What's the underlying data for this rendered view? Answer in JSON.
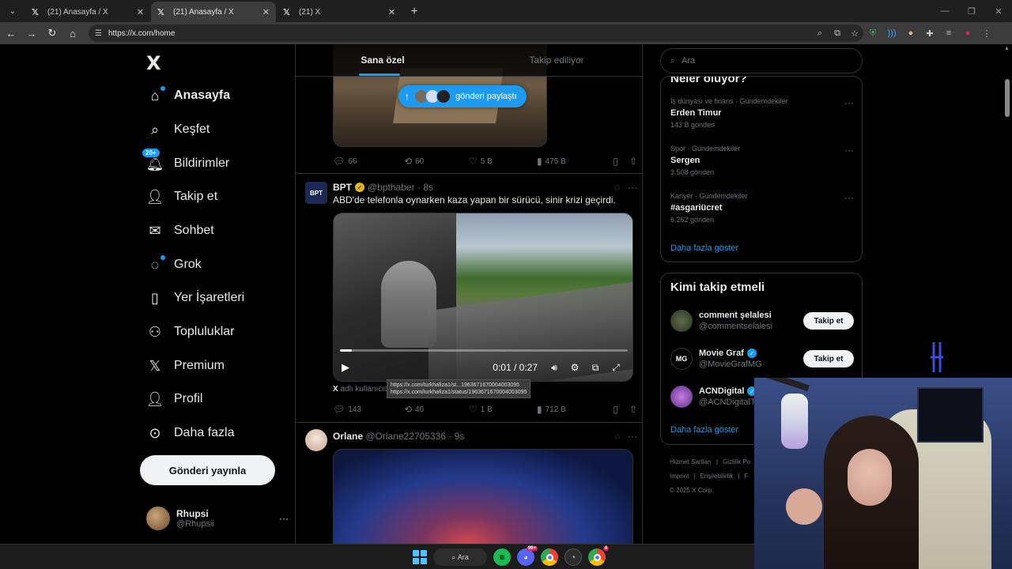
{
  "browser": {
    "tabs": [
      {
        "title": "(21) Anasayfa / X",
        "active": false
      },
      {
        "title": "(21) Anasayfa / X",
        "active": true
      },
      {
        "title": "(21) X",
        "active": false
      }
    ],
    "url": "https://x.com/home"
  },
  "sidebar": {
    "logo": "X",
    "items": [
      {
        "label": "Anasayfa",
        "icon": "home-icon"
      },
      {
        "label": "Keşfet",
        "icon": "search-icon"
      },
      {
        "label": "Bildirimler",
        "icon": "bell-icon",
        "badge": "20+"
      },
      {
        "label": "Takip et",
        "icon": "follow-icon"
      },
      {
        "label": "Sohbet",
        "icon": "mail-icon"
      },
      {
        "label": "Grok",
        "icon": "grok-icon"
      },
      {
        "label": "Yer İşaretleri",
        "icon": "bookmark-icon"
      },
      {
        "label": "Topluluklar",
        "icon": "communities-icon"
      },
      {
        "label": "Premium",
        "icon": "x-premium-icon"
      },
      {
        "label": "Profil",
        "icon": "profile-icon"
      },
      {
        "label": "Daha fazla",
        "icon": "more-circle-icon"
      }
    ],
    "post_button": "Gönderi yayınla",
    "account": {
      "name": "Rhupsi",
      "handle": "@Rhupsii"
    }
  },
  "timeline": {
    "tabs": [
      "Sana özel",
      "Takip ediliyor"
    ],
    "share_pill": "gönderi paylaştı",
    "post1_actions": {
      "replies": "66",
      "reposts": "60",
      "likes": "5 B",
      "views": "475 B"
    },
    "post2": {
      "name": "BPT",
      "handle": "@bpthaber",
      "time": "8s",
      "text": "ABD'de telefonla oynarken kaza yapan bir sürücü, sinir krizi geçirdi.",
      "video_time": "0:01 / 0:27",
      "video_progress": 0.04,
      "caption_prefix": "X",
      "caption_text": "adlı kullanıcıd",
      "tooltip_line1": "https://x.com/turkhafiza1/st...1963671670004003095",
      "tooltip_line2": "https://x.com/turkhafiza1/status/1963671670004003095",
      "actions": {
        "replies": "143",
        "reposts": "46",
        "likes": "1 B",
        "views": "712 B"
      }
    },
    "post3": {
      "name": "Orlane",
      "handle": "@Orlane22705336",
      "time": "9s"
    }
  },
  "right": {
    "search_placeholder": "Ara",
    "whats_happening_title": "Neler oluyor?",
    "trends": [
      {
        "meta": "İş dünyası ve finans · Gündemdekiler",
        "name": "Erden Timur",
        "count": "143 B gönderi"
      },
      {
        "meta": "Spor · Gündemdekiler",
        "name": "Sergen",
        "count": "3.508 gönderi"
      },
      {
        "meta": "Kariyer · Gündemdekiler",
        "name": "#asgariücret",
        "count": "6.262 gönderi"
      }
    ],
    "show_more": "Daha fazla göster",
    "who_to_follow_title": "Kimi takip etmeli",
    "follow": [
      {
        "name": "comment şelalesi",
        "handle": "@commentselalesi",
        "button": "Takip et",
        "verified": false
      },
      {
        "name": "Movie Graf",
        "handle": "@MovieGrafMG",
        "button": "Takip et",
        "verified": true
      },
      {
        "name": "ACNDigital",
        "handle": "@ACNDigitalT",
        "button": "",
        "verified": true
      }
    ],
    "show_more_2": "Daha fazla göster",
    "footer": {
      "l1a": "Hizmet Şartları",
      "l1b": "Gizlilik Po",
      "l2a": "Imprint",
      "l2b": "Erişilebilirlik",
      "l2c": "F",
      "l3": "© 2025 X Corp."
    }
  },
  "taskbar": {
    "search": "Ara",
    "discord_badge": "99+",
    "chrome_badge": "4"
  },
  "colors": {
    "accent": "#1d9bf0",
    "background": "#000000",
    "border": "#2f3336",
    "muted": "#71767b"
  }
}
